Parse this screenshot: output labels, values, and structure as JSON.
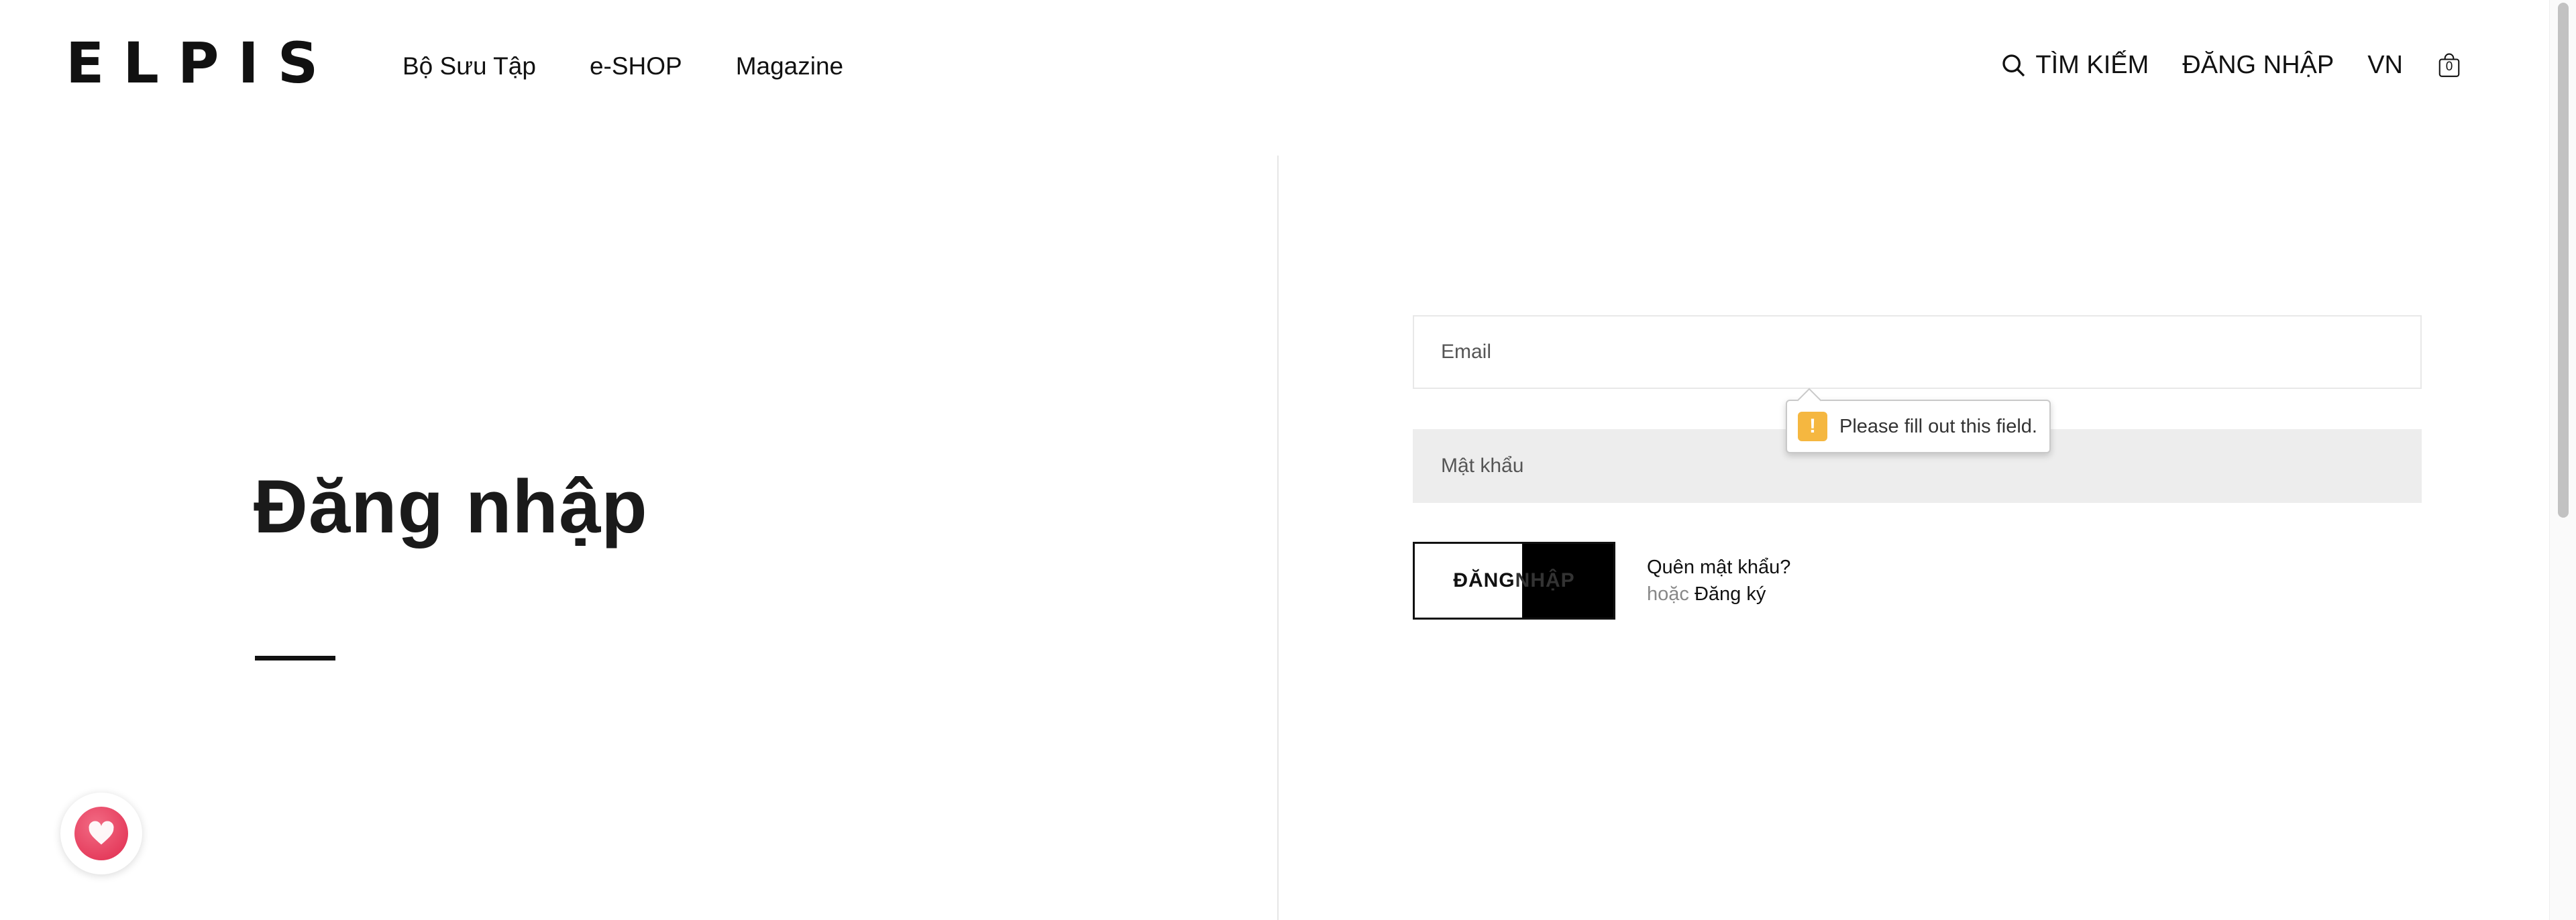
{
  "brand": {
    "logo_text": "ELPIS"
  },
  "nav": {
    "items": [
      {
        "label": "Bộ Sưu Tập"
      },
      {
        "label": "e-SHOP"
      },
      {
        "label": "Magazine"
      }
    ]
  },
  "header_right": {
    "search_label": "TÌM KIẾM",
    "login_label": "ĐĂNG NHẬP",
    "language": "VN",
    "cart_count": "0"
  },
  "page": {
    "title": "Đăng nhập"
  },
  "form": {
    "email_placeholder": "Email",
    "password_placeholder": "Mật khẩu",
    "validation_message": "Please fill out this field.",
    "submit_part1": "ĐĂNG ",
    "submit_part2": "NHẬP",
    "forgot_password": "Quên mật khẩu?",
    "or_text": "hoặc",
    "register_link": "Đăng ký"
  },
  "colors": {
    "warning": "#f5b740",
    "wishlist": "#e02b4e"
  }
}
